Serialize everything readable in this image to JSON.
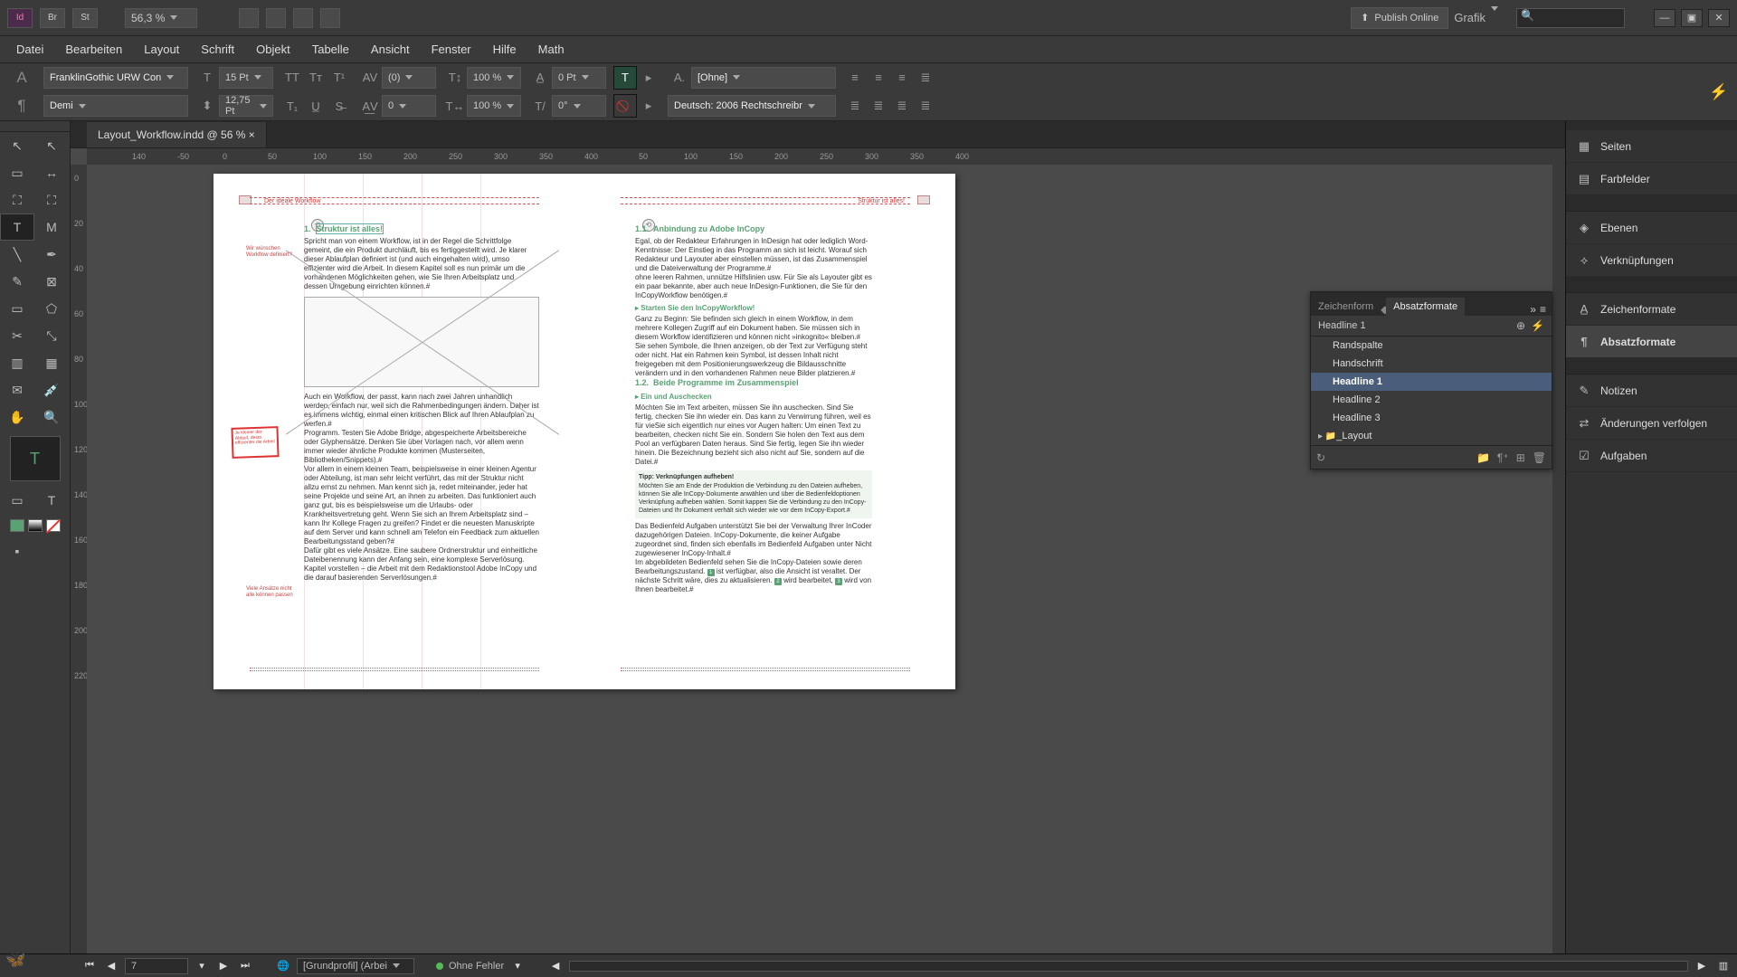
{
  "titlebar": {
    "app_icon": "Id",
    "br": "Br",
    "st": "St",
    "zoom": "56,3 %",
    "publish": "Publish Online",
    "workspace_label": "Grafik"
  },
  "window": {
    "min": "—",
    "max": "▣",
    "close": "✕"
  },
  "menu": {
    "items": [
      "Datei",
      "Bearbeiten",
      "Layout",
      "Schrift",
      "Objekt",
      "Tabelle",
      "Ansicht",
      "Fenster",
      "Hilfe",
      "Math"
    ]
  },
  "control": {
    "font": "FranklinGothic URW Con",
    "weight": "Demi",
    "size": "15 Pt",
    "leading": "12,75 Pt",
    "kerning": "(0)",
    "tracking": "0",
    "vscale": "100 %",
    "hscale": "100 %",
    "baseline": "0 Pt",
    "skew": "0°",
    "char_style": "[Ohne]",
    "lang": "Deutsch: 2006 Rechtschreibr"
  },
  "doc": {
    "tab": "Layout_Workflow.indd @ 56 %",
    "tab_close": "×"
  },
  "ruler_h": [
    "140",
    "-50",
    "0",
    "50",
    "100",
    "150",
    "200",
    "250",
    "300",
    "350",
    "400",
    "50",
    "100",
    "150",
    "200",
    "250",
    "300",
    "350",
    "400"
  ],
  "ruler_v": [
    "0",
    "20",
    "40",
    "60",
    "80",
    "100",
    "120",
    "140",
    "160",
    "180",
    "200",
    "220"
  ],
  "page_left": {
    "runhead": "Der ideale Workflow",
    "h1_num": "1.",
    "h1_title": "Struktur ist alles!",
    "sidenote1": "Wir wünschen Workflow definiert?",
    "para1": "Spricht man von einem Workflow, ist in der Regel die Schrittfolge gemeint, die ein Produkt durchläuft, bis es fertiggestellt wird. Je klarer dieser Ablaufplan definiert ist (und auch eingehalten wird), umso effizienter wird die Arbeit. In diesem Kapitel soll es nun primär um die vorhandenen Möglichkeiten gehen, wie Sie Ihren Arbeitsplatz und dessen Umgebung einrichten können.#",
    "para2": "Auch ein Workflow, der passt, kann nach zwei Jahren unhandlich werden, einfach nur, weil sich die Rahmenbedingungen ändern. Daher ist es immens wichtig, einmal einen kritischen Blick auf Ihren Ablaufplan zu werfen.#",
    "para3": "Programm. Testen Sie Adobe Bridge, abgespeicherte Arbeitsbereiche oder Glyphensätze. Denken Sie über Vorlagen nach, vor allem wenn immer wieder ähnliche Produkte kommen (Musterseiten, Bibliotheken/Snippets).#",
    "para4": "Vor allem in einem kleinen Team, beispielsweise in einer kleinen Agentur oder Abteilung, ist man sehr leicht verführt, das mit der Struktur nicht allzu ernst zu nehmen. Man kennt sich ja, redet miteinander, jeder hat seine Projekte und seine Art, an ihnen zu arbeiten. Das funktioniert auch ganz gut, bis es beispielsweise um die Urlaubs- oder Krankheitsvertretung geht. Wenn Sie sich an Ihrem Arbeitsplatz sind – kann Ihr Kollege Fragen zu greifen? Findet er die neuesten Manuskripte auf dem Server und kann schnell am Telefon ein Feedback zum aktuellen Bearbeitungsstand geben?#",
    "para5": "Dafür gibt es viele Ansätze. Eine saubere Ordnerstruktur und einheitliche Dateibenennung kann der Anfang sein, eine komplexe Serverlösung. Kapitel vorstellen – die Arbeit mit dem Redaktionstool Adobe InCopy und die darauf basierenden Serverlösungen.#",
    "sidenote2": "Je kleiner der Ablauf, desto effizienter die Arbeit",
    "sidenote3": "Viele Ansätze nicht alle können passen"
  },
  "page_right": {
    "runhead": "Struktur ist alles!",
    "h1_num": "1.1.",
    "h1_title": "Anbindung zu Adobe InCopy",
    "para1": "Egal, ob der Redakteur Erfahrungen in InDesign hat oder lediglich Word-Kenntnisse: Der Einstieg in das Programm an sich ist leicht. Worauf sich Redakteur und Layouter aber einstellen müssen, ist das Zusammenspiel und die Dateiverwaltung der Programme.#",
    "para2": "ohne leeren Rahmen, unnütze Hilfslinien usw. Für Sie als Layouter gibt es ein paar bekannte, aber auch neue InDesign-Funktionen, die Sie für den InCopyWorkflow benötigen.#",
    "h2": "▸  Starten Sie den InCopyWorkflow!",
    "para3": "Ganz zu Beginn: Sie befinden sich gleich in einem Workflow, in dem mehrere Kollegen Zugriff auf ein Dokument haben. Sie müssen sich in diesem Workflow identifizieren und können nicht »inkognito« bleiben.#",
    "para4": "Sie sehen Symbole, die Ihnen anzeigen, ob der Text zur Verfügung steht oder nicht. Hat ein Rahmen kein Symbol, ist dessen Inhalt nicht freigegeben mit dem Positionierungswerkzeug die Bildausschnitte verändern und in den vorhandenen Rahmen neue Bilder platzieren.#",
    "h3_num": "1.2.",
    "h3_title": "Beide Programme im Zusammenspiel",
    "h4": "▸  Ein und Auschecken",
    "para5": "Möchten Sie im Text arbeiten, müssen Sie ihn auschecken. Sind Sie fertig, checken Sie ihn wieder ein. Das kann zu Verwirrung führen, weil es für vieSie sich eigentlich nur eines vor Augen halten: Um einen Text zu bearbeiten, checken nicht Sie ein. Sondern Sie holen den Text aus dem Pool an verfügbaren Daten heraus. Sind Sie fertig, legen Sie ihn wieder hinein. Die Bezeichnung bezieht sich also nicht auf Sie, sondern auf die Datei.#",
    "tip_head": "Tipp: Verknüpfungen aufheben!",
    "tip_body": "Möchten Sie am Ende der Produktion die Verbindung zu den Dateien aufheben, können Sie alle InCopy-Dokumente anwählen und über die Bedienfeldoptionen Verknüpfung aufheben wählen. Somit kappen Sie die Verbindung zu den InCopy-Dateien und Ihr Dokument verhält sich wieder wie vor dem InCopy-Export.#",
    "para6": "Das Bedienfeld Aufgaben unterstützt Sie bei der Verwaltung Ihrer InCoder dazugehörigen Dateien. InCopy-Dokumente, die keiner Aufgabe zugeordnet sind, finden sich ebenfalls im Bedienfeld Aufgaben unter Nicht zugewiesener InCopy-Inhalt.#",
    "para7_pre": "Im abgebildeten Bedienfeld sehen Sie die InCopy-Dateien sowie deren Bearbeitungszustand. ",
    "para7_b1": "1",
    "para7_m1": " ist verfügbar, also die Ansicht ist veraltet. Der nächste Schritt wäre, dies zu aktualisieren. ",
    "para7_b2": "2",
    "para7_m2": " wird bearbeitet, ",
    "para7_b3": "3",
    "para7_m3": " wird von Ihnen bearbeitet.#"
  },
  "panel": {
    "tab1": "Zeichenform",
    "tab2": "Absatzformate",
    "status": "Headline 1",
    "styles": [
      "Randspalte",
      "Handschrift",
      "Headline 1",
      "Headline 2",
      "Headline 3"
    ],
    "folder": "_Layout"
  },
  "dock": {
    "items": [
      {
        "ic": "▦",
        "label": "Seiten"
      },
      {
        "ic": "▤",
        "label": "Farbfelder"
      },
      {
        "ic": "◈",
        "label": "Ebenen"
      },
      {
        "ic": "⟡",
        "label": "Verknüpfungen"
      },
      {
        "ic": "A̲",
        "label": "Zeichenformate"
      },
      {
        "ic": "¶",
        "label": "Absatzformate",
        "sel": true
      },
      {
        "ic": "✎",
        "label": "Notizen"
      },
      {
        "ic": "⇄",
        "label": "Änderungen verfolgen"
      },
      {
        "ic": "☑",
        "label": "Aufgaben"
      }
    ]
  },
  "status": {
    "page": "7",
    "profile": "[Grundprofil] (Arbei",
    "errors": "Ohne Fehler"
  }
}
